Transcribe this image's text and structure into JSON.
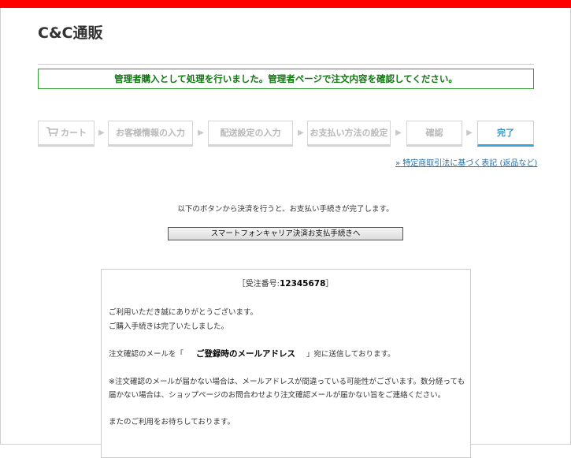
{
  "header": {
    "logo": "C&C通販",
    "notice": "管理者購入として処理を行いました。管理者ページで注文内容を確認してください。"
  },
  "steps": [
    {
      "label": "カート",
      "active": false
    },
    {
      "label": "お客様情報の入力",
      "active": false
    },
    {
      "label": "配送設定の入力",
      "active": false
    },
    {
      "label": "お支払い方法の設定",
      "active": false
    },
    {
      "label": "確認",
      "active": false
    },
    {
      "label": "完了",
      "active": true
    }
  ],
  "legal_link": "» 特定商取引法に基づく表記 (返品など)",
  "instruction": "以下のボタンから決済を行うと、お支払い手続きが完了します。",
  "pay_button": "スマートフォンキャリア決済お支払手続きへ",
  "confirmation": {
    "order_prefix": "［受注番号:",
    "order_number": "12345678",
    "order_suffix": "］",
    "thanks_1": "ご利用いただき誠にありがとうございます。",
    "thanks_2": "ご購入手続きは完了いたしました。",
    "mail_prefix": "注文確認のメールを「",
    "mail_address": "ご登録時のメールアドレス",
    "mail_suffix": "」宛に送信しております。",
    "warning_1": "※注文確認のメールが届かない場合は、メールアドレスが間違っている可能性がございます。数分経っても",
    "warning_2": "届かない場合は、ショップページのお問合わせより注文確認メールが届かない旨をご連絡ください。",
    "closing": "またのご利用をお待ちしております。"
  },
  "colors": {
    "top_bar": "#ff0000",
    "notice_border": "#339933",
    "notice_text": "#117711",
    "active_step": "#3aa6d9",
    "link": "#2a6fa0"
  }
}
